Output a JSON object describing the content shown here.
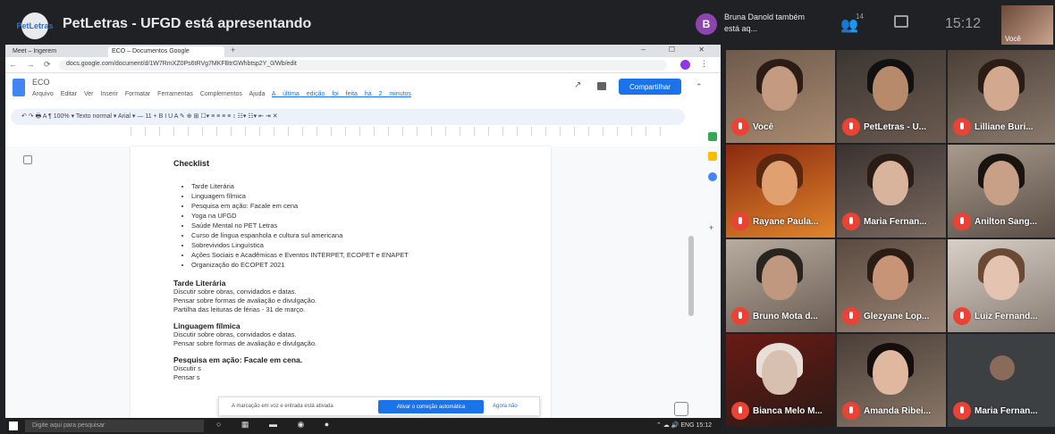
{
  "meet": {
    "presenter_logo": "PetLetras",
    "title": "PetLetras - UFGD está apresentando",
    "notification": {
      "avatar_letter": "B",
      "text": "Bruna Danold também está aq..."
    },
    "participants_count": "14",
    "clock": "15:12",
    "self_label": "Você"
  },
  "browser": {
    "tabs": [
      {
        "label": "Meet – Ingerem"
      },
      {
        "label": "ECO – Documentos Google"
      }
    ],
    "url": "docs.google.com/document/d/1W7RmXZ0Ps6tRVg7MKFBtrGWhbtsp2Y_0/Wb/edit"
  },
  "docs": {
    "title": "ECO",
    "menu": [
      "Arquivo",
      "Editar",
      "Ver",
      "Inserir",
      "Formatar",
      "Ferramentas",
      "Complementos",
      "Ajuda"
    ],
    "last_edit": "A última edição foi feita há 2 minutos",
    "share_label": "Compartilhar",
    "toolbar_text": "↶ ↷ 🖶 A ¶   100% ▾   Texto normal ▾   Arial ▾   —  11  +   B  I  U  A  ✎   ⊕  ⊞  ☐▾   ≡ ≡ ≡ ≡   ↕   ☷▾ ☷▾  ⇤ ⇥  ✕",
    "checklist_title": "Checklist",
    "checklist_items": [
      "Tarde Literária",
      "Linguagem fílmica",
      "Pesquisa em ação: Facale em cena",
      "Yoga na UFGD",
      "Saúde Mental no PET Letras",
      "Curso de língua espanhola e cultura sul americana",
      "Sobrevividos Linguística",
      "Ações Sociais e Acadêmicas e Eventos INTERPET, ECOPET e ENAPET",
      "Organização do ECOPET 2021"
    ],
    "sections": [
      {
        "heading": "Tarde Literária",
        "lines": [
          "Discutir sobre obras, convidados e datas.",
          "Pensar sobre formas de avaliação e divulgação.",
          "Partilha das leituras de férias - 31 de março."
        ]
      },
      {
        "heading": "Linguagem fílmica",
        "lines": [
          "Discutir sobre obras, convidados e datas.",
          "Pensar sobre formas de avaliação e divulgação."
        ]
      },
      {
        "heading": "Pesquisa em ação: Facale em cena.",
        "lines": [
          "Discutir s",
          "Pensar s"
        ]
      }
    ],
    "snackbar": {
      "message": "A marcação em voz e entrada está ativada",
      "action": "Ativar o correção automática",
      "dismiss": "Agora não"
    }
  },
  "taskbar": {
    "search_placeholder": "Digite aqui para pesquisar",
    "tray": "⌃ ☁ 🔊 ENG  15:12"
  },
  "participants": [
    {
      "name": "Você"
    },
    {
      "name": "PetLetras - U..."
    },
    {
      "name": "Lilliane Buri..."
    },
    {
      "name": "Rayane Paula..."
    },
    {
      "name": "Maria Fernan..."
    },
    {
      "name": "Anilton Sang..."
    },
    {
      "name": "Bruno Mota d..."
    },
    {
      "name": "Glezyane Lop..."
    },
    {
      "name": "Luiz Fernand..."
    },
    {
      "name": "Bianca Melo M..."
    },
    {
      "name": "Amanda Ribei..."
    },
    {
      "name": "Maria Fernan..."
    }
  ]
}
